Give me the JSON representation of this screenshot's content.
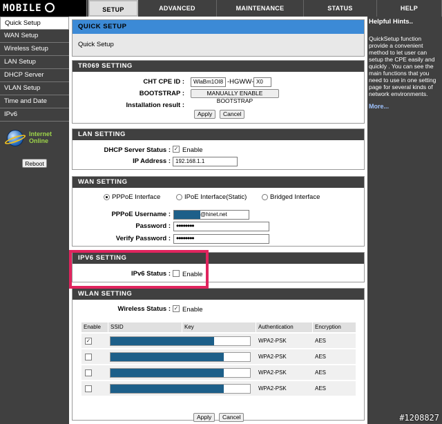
{
  "logo": {
    "text": "MOBILE"
  },
  "nav": {
    "tabs": [
      "SETUP",
      "ADVANCED",
      "MAINTENANCE",
      "STATUS",
      "HELP"
    ]
  },
  "sidebar": {
    "items": [
      "Quick Setup",
      "WAN Setup",
      "Wireless Setup",
      "LAN Setup",
      "DHCP Server",
      "VLAN Setup",
      "Time and Date",
      "IPv6"
    ],
    "status_line1": "Internet",
    "status_line2": "Online",
    "reboot_label": "Reboot"
  },
  "quick_setup": {
    "title": "QUICK SETUP",
    "text": "Quick Setup"
  },
  "tr069": {
    "title": "TR069 SETTING",
    "cpe_label": "CHT CPE ID :",
    "cpe_value": "WlaBm1OI8",
    "cpe_mid": "-HGWW-",
    "cpe_suffix": "X0",
    "bootstrap_label": "BOOTSTRAP :",
    "bootstrap_button": "MANUALLY ENABLE BOOTSTRAP",
    "result_label": "Installation result :",
    "apply": "Apply",
    "cancel": "Cancel"
  },
  "lan": {
    "title": "LAN SETTING",
    "dhcp_label": "DHCP Server Status :",
    "dhcp_check": "✓",
    "dhcp_text": "Enable",
    "ip_label": "IP Address :",
    "ip_value": "192.168.1.1"
  },
  "wan": {
    "title": "WAN SETTING",
    "opt1": "PPPoE Interface",
    "opt2": "IPoE Interface(Static)",
    "opt3": "Bridged Interface",
    "user_label": "PPPoE Username :",
    "user_value": "@hinet.net",
    "pass_label": "Password :",
    "pass_value": "••••••••",
    "verify_label": "Verify Password :",
    "verify_value": "••••••••"
  },
  "ipv6": {
    "title": "IPV6 SETTING",
    "status_label": "IPv6 Status :",
    "status_text": "Enable"
  },
  "wlan": {
    "title": "WLAN SETTING",
    "status_label": "Wireless Status :",
    "status_check": "✓",
    "status_text": "Enable",
    "headers": [
      "Enable",
      "SSID",
      "Key",
      "Authentication",
      "Encryption"
    ],
    "rows": [
      {
        "check": "✓",
        "auth": "WPA2-PSK",
        "enc": "AES"
      },
      {
        "check": "",
        "auth": "WPA2-PSK",
        "enc": "AES"
      },
      {
        "check": "",
        "auth": "WPA2-PSK",
        "enc": "AES"
      },
      {
        "check": "",
        "auth": "WPA2-PSK",
        "enc": "AES"
      }
    ],
    "apply": "Apply",
    "cancel": "Cancel"
  },
  "hints": {
    "title": "Helpful Hints..",
    "body": "QuickSetup function provide a convenient method to let user can setup the CPE easily and quickly . You can see the main functions that you need to use in one setting page for several kinds of network environments.",
    "more": "More..."
  },
  "watermark": "#1208827",
  "colors": {
    "accent": "#3c8ad6",
    "highlight": "#e0245e",
    "redaction": "#1d5f89"
  }
}
